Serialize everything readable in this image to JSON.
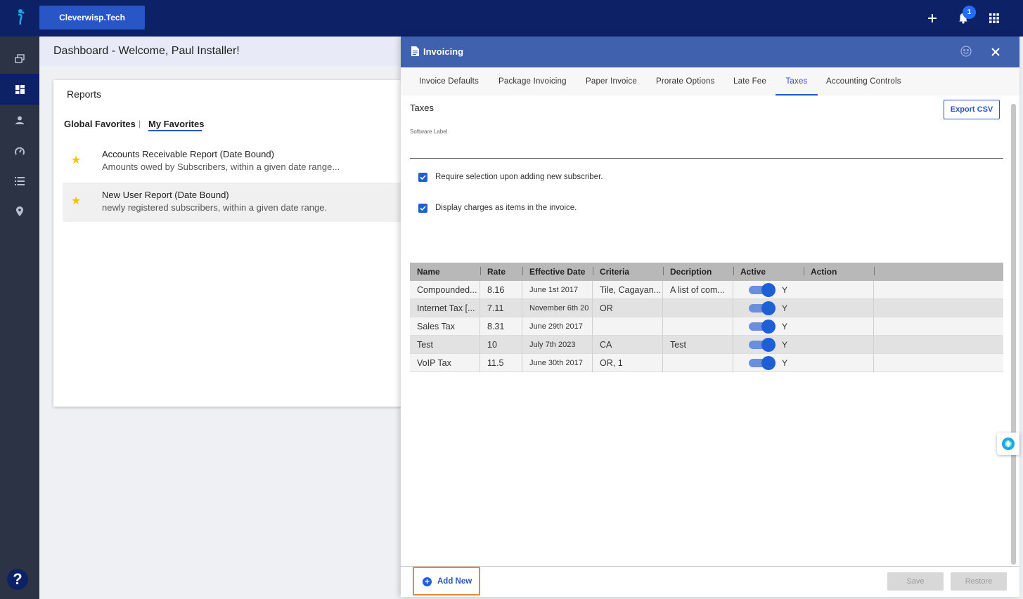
{
  "topbar": {
    "brand": "Cleverwisp.Tech",
    "notification_count": "1"
  },
  "sidebar": {
    "items": [
      {
        "icon": "switch-icon"
      },
      {
        "icon": "dashboard-icon",
        "active": true
      },
      {
        "icon": "user-icon"
      },
      {
        "icon": "gauge-icon"
      },
      {
        "icon": "list-icon"
      },
      {
        "icon": "location-icon"
      }
    ],
    "help": "?"
  },
  "dashboard": {
    "title": "Dashboard - Welcome, Paul Installer!",
    "reports": {
      "title": "Reports",
      "tabs": [
        "Global Favorites",
        "My Favorites"
      ],
      "separator": "|",
      "active_tab": "My Favorites",
      "items": [
        {
          "name": "Accounts Receivable Report (Date Bound)",
          "description": "Amounts owed by Subscribers, within a given date range..."
        },
        {
          "name": "New User Report (Date Bound)",
          "description": "newly registered subscribers, within a given date range."
        }
      ]
    }
  },
  "panel": {
    "title": "Invoicing",
    "tabs": [
      "Invoice Defaults",
      "Package Invoicing",
      "Paper Invoice",
      "Prorate Options",
      "Late Fee",
      "Taxes",
      "Accounting Controls"
    ],
    "active_tab": "Taxes",
    "section_title": "Taxes",
    "export_label": "Export CSV",
    "software_label": "Software Label",
    "checkboxes": [
      {
        "label": "Require selection upon adding new subscriber.",
        "checked": true
      },
      {
        "label": "Display charges as items in the invoice.",
        "checked": true
      }
    ],
    "table": {
      "columns": [
        "Name",
        "Rate",
        "Effective Date",
        "Criteria",
        "Decription",
        "Active",
        "Action"
      ],
      "rows": [
        {
          "name": "Compounded...",
          "rate": "8.16",
          "date": "June 1st 2017",
          "criteria": "Tile, Cagayan...",
          "description": "A list of com...",
          "active": "Y"
        },
        {
          "name": "Internet Tax [...",
          "rate": "7.11",
          "date": "November 6th 20",
          "criteria": "OR",
          "description": "",
          "active": "Y"
        },
        {
          "name": "Sales Tax",
          "rate": "8.31",
          "date": "June 29th 2017",
          "criteria": "",
          "description": "",
          "active": "Y"
        },
        {
          "name": "Test",
          "rate": "10",
          "date": "July 7th 2023",
          "criteria": "CA",
          "description": "Test",
          "active": "Y"
        },
        {
          "name": "VoIP Tax",
          "rate": "11.5",
          "date": "June 30th 2017",
          "criteria": "OR, 1",
          "description": "",
          "active": "Y"
        }
      ]
    },
    "footer": {
      "add_new": "Add New",
      "save": "Save",
      "restore": "Restore"
    }
  },
  "colors": {
    "topbar": "#0d2167",
    "brand": "#2856c6",
    "panel_header": "#4061ad",
    "accent": "#1f5fd6",
    "highlight_border": "#e8893a"
  }
}
